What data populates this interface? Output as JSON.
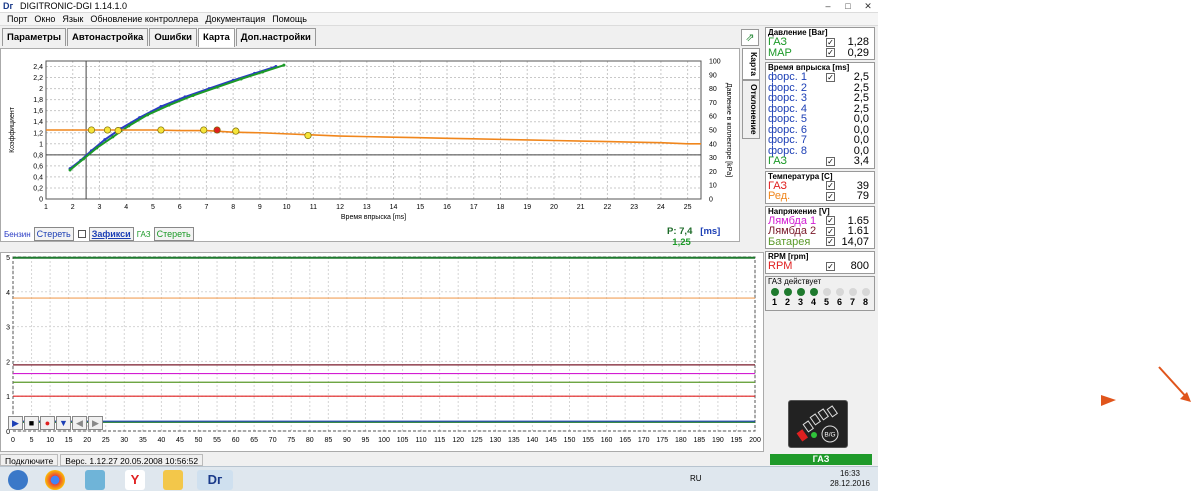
{
  "window": {
    "logo": "Dг",
    "title": "DIGITRONIC-DGI   1.14.1.0",
    "buttons": [
      "–",
      "□",
      "✕"
    ]
  },
  "menu": [
    "Порт",
    "Окно",
    "Язык",
    "Обновление контроллера",
    "Документация",
    "Помощь"
  ],
  "tabs": [
    {
      "label": "Параметры",
      "active": false
    },
    {
      "label": "Автонастройка",
      "active": false
    },
    {
      "label": "Ошибки",
      "active": false
    },
    {
      "label": "Карта",
      "active": true
    },
    {
      "label": "Доп.настройки",
      "active": false
    }
  ],
  "side_tabs": [
    "Карта",
    "Отклонение"
  ],
  "map_chart": {
    "ylabel_left": "Коэффициент",
    "ylabel_right": "Давление в коллекторе [kPa]",
    "xlabel": "Время впрыска [ms]",
    "legend": {
      "benzin": "Бензин",
      "clear1": "Стереть",
      "fix": "Зафикси",
      "gas": "ГАЗ",
      "clear2": "Стереть"
    },
    "readout_p": "P:",
    "readout_p_val": "7,4",
    "readout_unit": "[ms]",
    "readout_coef": "1,25"
  },
  "chart_data": [
    {
      "type": "scatter",
      "x_ticks": [
        "1",
        "2",
        "3",
        "4",
        "5",
        "6",
        "7",
        "8",
        "9",
        "10",
        "11",
        "12",
        "13",
        "14",
        "15",
        "16",
        "17",
        "18",
        "19",
        "20",
        "21",
        "22",
        "23",
        "24",
        "25"
      ],
      "y_left_ticks": [
        "0",
        "0,2",
        "0,4",
        "0,6",
        "0,8",
        "1",
        "1,2",
        "1,4",
        "1,6",
        "1,8",
        "2",
        "2,2",
        "2,4"
      ],
      "y_right_ticks": [
        "0",
        "10",
        "20",
        "30",
        "40",
        "50",
        "60",
        "70",
        "80",
        "90",
        "100"
      ],
      "xlim": [
        1,
        25.5
      ],
      "ylim": [
        0,
        2.5
      ],
      "ylim_right": [
        0,
        100
      ],
      "series": [
        {
          "name": "Бензин",
          "color": "#2a3bc4",
          "axis": "right",
          "x": [
            1.9,
            2.3,
            2.7,
            3.2,
            3.8,
            4.5,
            5.3,
            6.2,
            7.1,
            8.0,
            8.8,
            9.6
          ],
          "y": [
            22,
            28,
            35,
            43,
            51,
            59,
            67,
            74,
            80,
            86,
            91,
            96
          ]
        },
        {
          "name": "ГАЗ",
          "color": "#1c9a28",
          "axis": "right",
          "x": [
            1.9,
            2.4,
            2.9,
            3.5,
            4.1,
            4.8,
            5.6,
            6.5,
            7.4,
            8.3,
            9.1,
            9.9
          ],
          "y": [
            21,
            29,
            37,
            45,
            53,
            61,
            68,
            75,
            81,
            87,
            92,
            97
          ]
        },
        {
          "name": "Коэффициент",
          "color": "#f0861c",
          "axis": "left",
          "x": [
            1,
            2,
            3,
            4,
            5,
            6,
            7,
            8,
            9,
            10,
            11,
            12,
            13,
            14,
            15,
            16,
            17,
            18,
            19,
            20,
            21,
            22,
            23,
            24,
            25,
            25.5
          ],
          "y": [
            1.25,
            1.25,
            1.25,
            1.25,
            1.25,
            1.24,
            1.24,
            1.21,
            1.2,
            1.18,
            1.16,
            1.14,
            1.13,
            1.12,
            1.11,
            1.1,
            1.09,
            1.08,
            1.07,
            1.06,
            1.05,
            1.04,
            1.03,
            1.02,
            1.0,
            1.0
          ]
        },
        {
          "name": "points",
          "color": "#f6e53a",
          "axis": "left",
          "x": [
            2.7,
            3.3,
            3.7,
            5.3,
            6.9,
            7.4,
            8.1,
            10.8
          ],
          "y": [
            1.25,
            1.25,
            1.24,
            1.25,
            1.25,
            1.25,
            1.23,
            1.15
          ]
        }
      ],
      "cursor_x": 7.4,
      "vertical_lines_x": [
        2.5
      ]
    },
    {
      "type": "line",
      "x_ticks": [
        "0",
        "5",
        "10",
        "15",
        "20",
        "25",
        "30",
        "35",
        "40",
        "45",
        "50",
        "55",
        "60",
        "65",
        "70",
        "75",
        "80",
        "85",
        "90",
        "95",
        "100",
        "105",
        "110",
        "115",
        "120",
        "125",
        "130",
        "135",
        "140",
        "145",
        "150",
        "155",
        "160",
        "165",
        "170",
        "175",
        "180",
        "185",
        "190",
        "195",
        "200"
      ],
      "y_ticks": [
        "0",
        "1",
        "2",
        "3",
        "4",
        "5"
      ],
      "xlim": [
        0,
        200
      ],
      "ylim": [
        0,
        5
      ],
      "series": [
        {
          "color": "#1f7a2e",
          "values_const": 4.98
        },
        {
          "color": "#f0a05a",
          "values_const": 3.82
        },
        {
          "color": "#7a1a2a",
          "values_const": 1.9
        },
        {
          "color": "#d21ed2",
          "values_const": 1.65
        },
        {
          "color": "#5a9a2a",
          "values_const": 1.4
        },
        {
          "color": "#e02020",
          "values_const": 1.0
        },
        {
          "color": "#1c3fb5",
          "values_const": 0.28
        },
        {
          "color": "#1f7a2e",
          "values_const": 0.25
        }
      ]
    }
  ],
  "side": {
    "pressure": {
      "header": "Давление [Bar]",
      "rows": [
        {
          "label": "ГАЗ",
          "color": "#1c9a28",
          "value": "1,28"
        },
        {
          "label": "MAP",
          "color": "#1c9a28",
          "value": "0,29"
        }
      ]
    },
    "injection": {
      "header": "Время впрыска [ms]",
      "rows": [
        {
          "label": "форс. 1",
          "color": "#1c3fb5",
          "value": "2,5",
          "checked": true
        },
        {
          "label": "форс. 2",
          "color": "#1c3fb5",
          "value": "2,5",
          "checked": false
        },
        {
          "label": "форс. 3",
          "color": "#1c3fb5",
          "value": "2,5",
          "checked": false
        },
        {
          "label": "форс. 4",
          "color": "#1c3fb5",
          "value": "2,5",
          "checked": false
        },
        {
          "label": "форс. 5",
          "color": "#1c3fb5",
          "value": "0,0",
          "checked": false
        },
        {
          "label": "форс. 6",
          "color": "#1c3fb5",
          "value": "0,0",
          "checked": false
        },
        {
          "label": "форс. 7",
          "color": "#1c3fb5",
          "value": "0,0",
          "checked": false
        },
        {
          "label": "форс. 8",
          "color": "#1c3fb5",
          "value": "0,0",
          "checked": false
        },
        {
          "label": "ГАЗ",
          "color": "#1c9a28",
          "value": "3,4",
          "checked": true
        }
      ]
    },
    "temperature": {
      "header": "Температура [C]",
      "rows": [
        {
          "label": "ГАЗ",
          "color": "#e02020",
          "value": "39"
        },
        {
          "label": "Ред.",
          "color": "#f0861c",
          "value": "79"
        }
      ]
    },
    "voltage": {
      "header": "Напряжение [V]",
      "rows": [
        {
          "label": "Лямбда 1",
          "color": "#d21ed2",
          "value": "1.65"
        },
        {
          "label": "Лямбда 2",
          "color": "#7a1a2a",
          "value": "1.61"
        },
        {
          "label": "Батарея",
          "color": "#5a9a2a",
          "value": "14,07"
        }
      ]
    },
    "rpm": {
      "header": "RPM [rpm]",
      "rows": [
        {
          "label": "RPM",
          "color": "#e02020",
          "value": "800"
        }
      ]
    },
    "gas_active": {
      "header": "ГАЗ действует",
      "indicators": [
        {
          "label": "1",
          "on": true
        },
        {
          "label": "2",
          "on": true
        },
        {
          "label": "3",
          "on": true
        },
        {
          "label": "4",
          "on": true
        },
        {
          "label": "5",
          "on": false
        },
        {
          "label": "6",
          "on": false
        },
        {
          "label": "7",
          "on": false
        },
        {
          "label": "8",
          "on": false
        }
      ]
    },
    "gauge_label": "B/G",
    "gas_status": "ГАЗ"
  },
  "statusbar": {
    "connection": "Подключите",
    "version": "Верс. 1.12.27   20.05.2008   10:56:52"
  },
  "taskbar": {
    "lang": "RU",
    "time": "16:33",
    "date": "28.12.2016",
    "app_label": "Dг"
  }
}
